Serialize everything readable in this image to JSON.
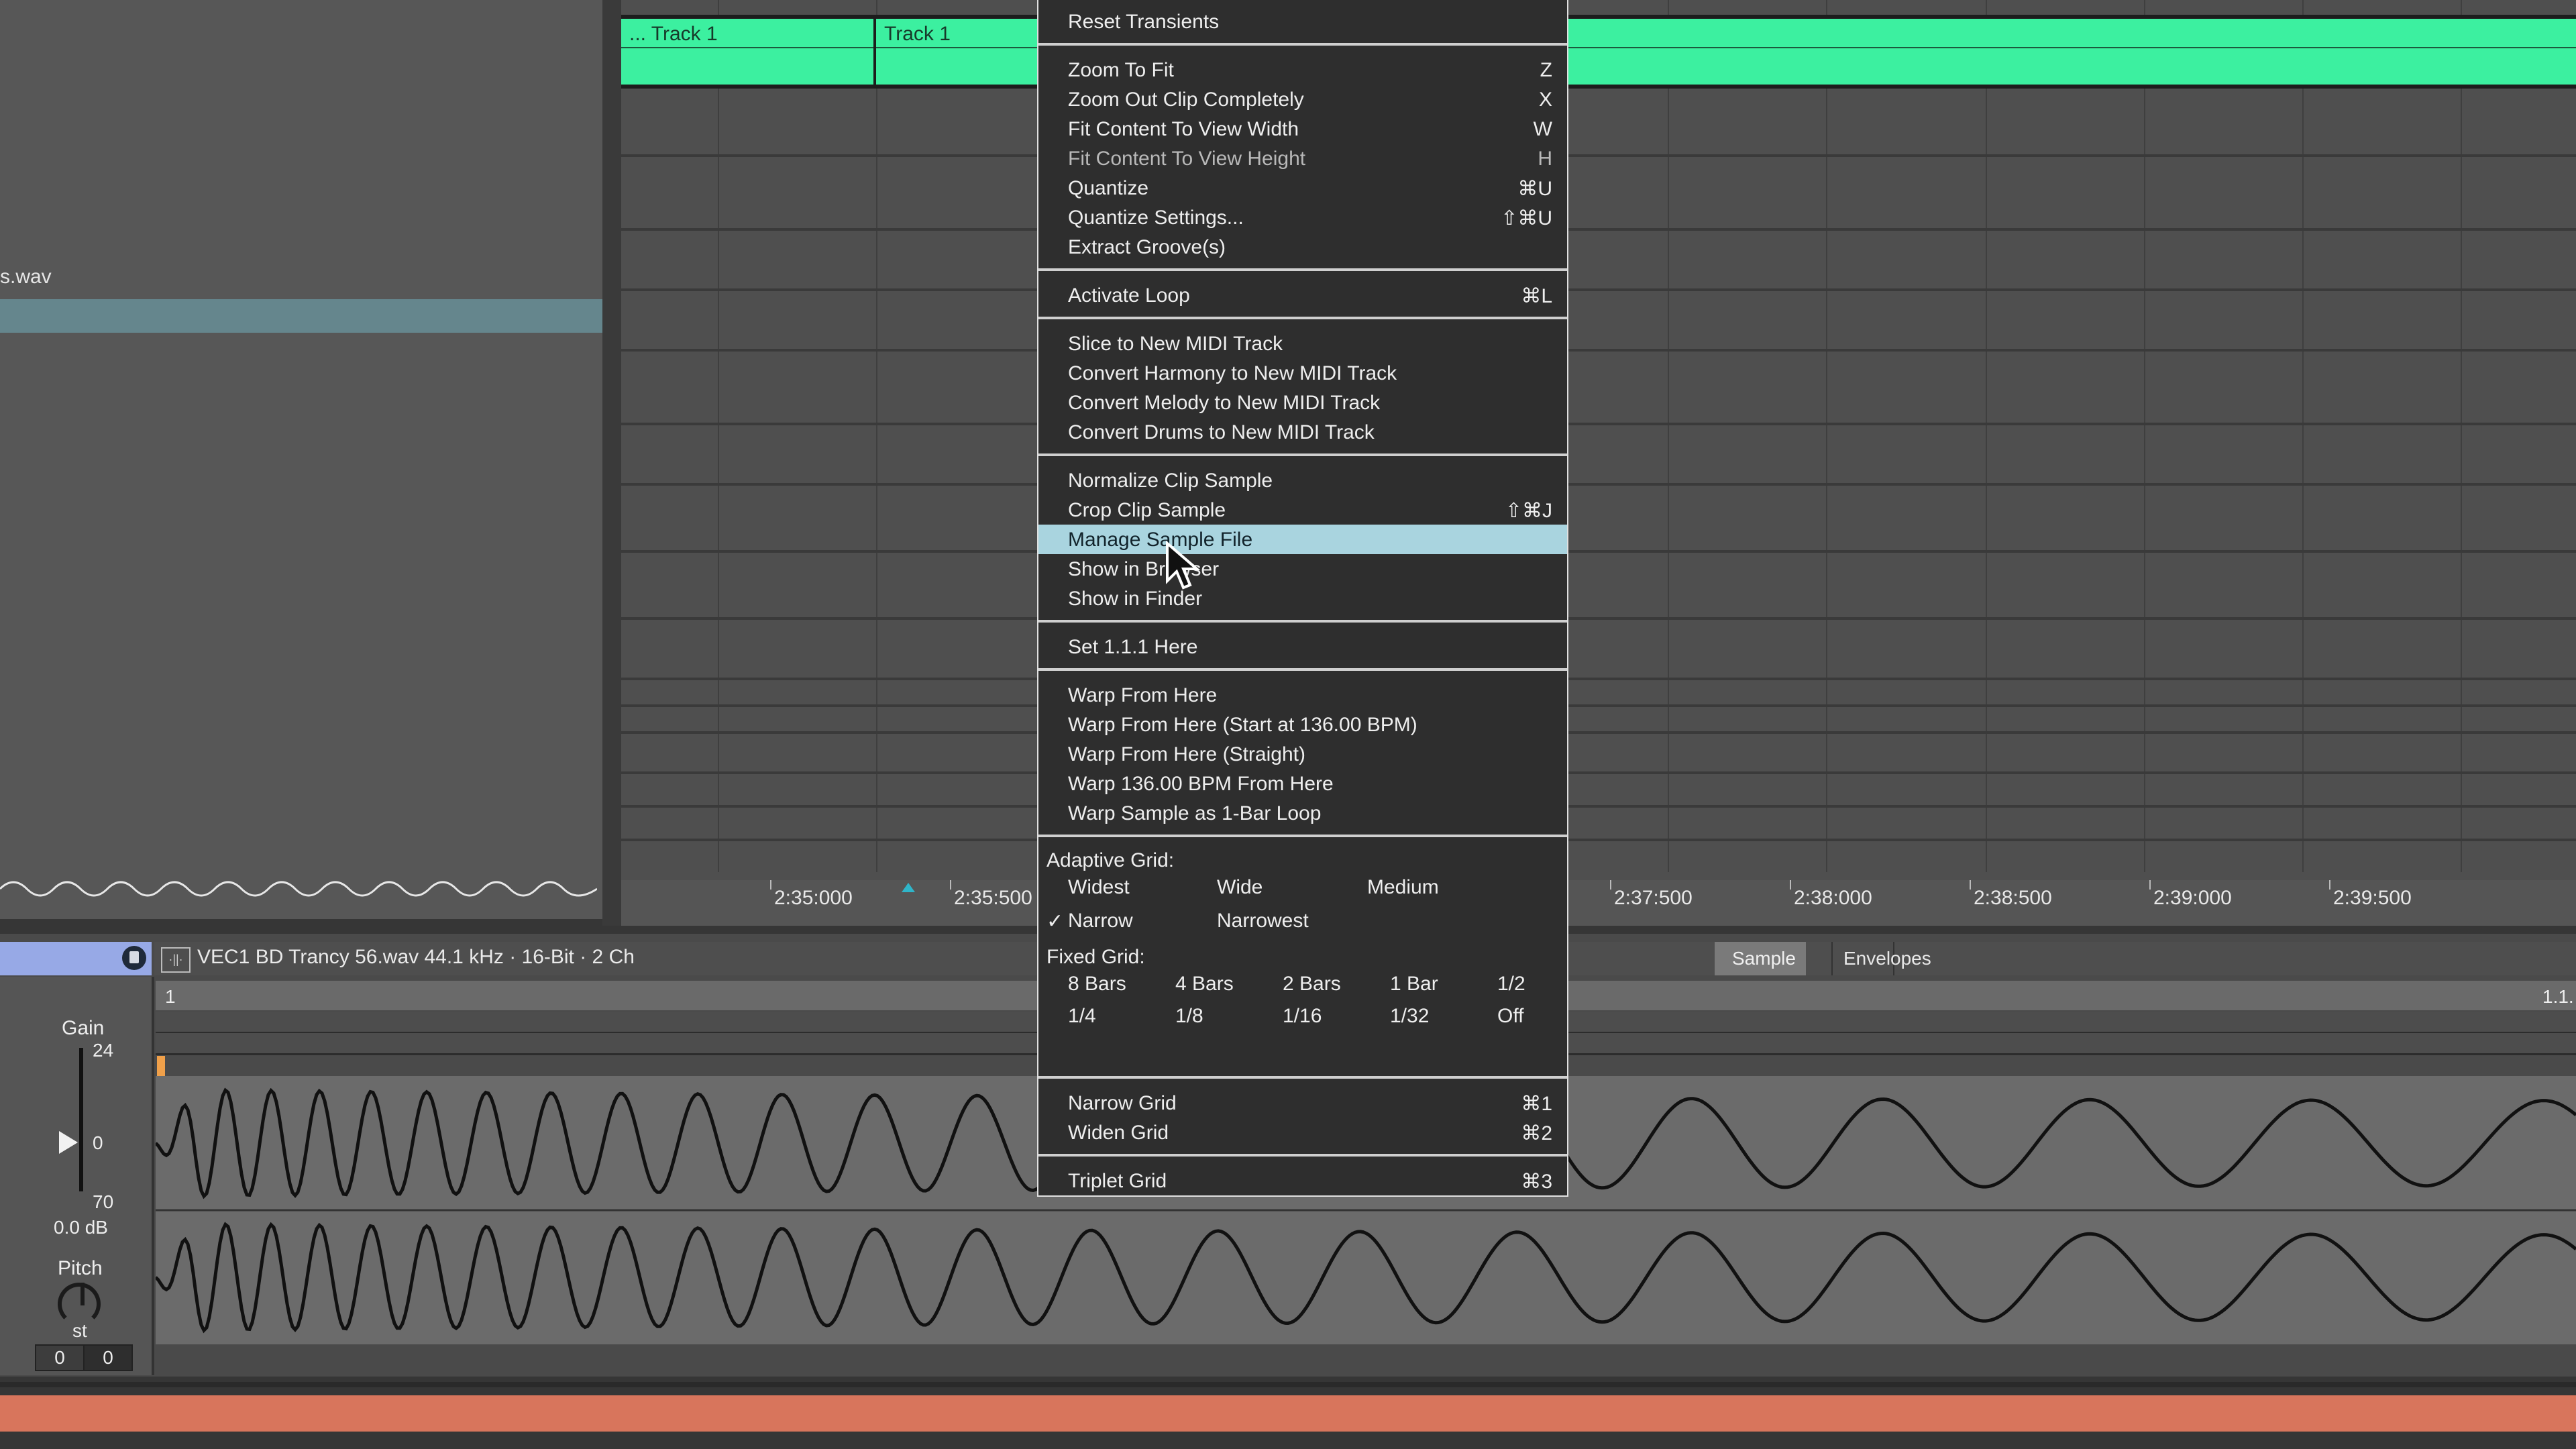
{
  "browser": {
    "file_name_fragment": "s.wav"
  },
  "arrangement": {
    "clips": [
      {
        "label": "... Track 1"
      },
      {
        "label": "Track 1"
      }
    ],
    "clip_color": "#3cf0a0",
    "ruler_ticks": [
      "2:35:000",
      "2:35:500",
      "2:37:500",
      "2:38:000",
      "2:38:500",
      "2:39:000",
      "2:39:500"
    ]
  },
  "context_menu": {
    "sections": [
      {
        "items": [
          {
            "label": "Reset Transients",
            "shortcut": "",
            "disabled": false
          }
        ]
      },
      {
        "items": [
          {
            "label": "Zoom To Fit",
            "shortcut": "Z"
          },
          {
            "label": "Zoom Out Clip Completely",
            "shortcut": "X"
          },
          {
            "label": "Fit Content To View Width",
            "shortcut": "W"
          },
          {
            "label": "Fit Content To View Height",
            "shortcut": "H",
            "disabled": true
          },
          {
            "label": "Quantize",
            "shortcut": "⌘U"
          },
          {
            "label": "Quantize Settings...",
            "shortcut": "⇧⌘U"
          },
          {
            "label": "Extract Groove(s)",
            "shortcut": ""
          }
        ]
      },
      {
        "items": [
          {
            "label": "Activate Loop",
            "shortcut": "⌘L"
          }
        ]
      },
      {
        "items": [
          {
            "label": "Slice to New MIDI Track",
            "shortcut": ""
          },
          {
            "label": "Convert Harmony to New MIDI Track",
            "shortcut": ""
          },
          {
            "label": "Convert Melody to New MIDI Track",
            "shortcut": ""
          },
          {
            "label": "Convert Drums to New MIDI Track",
            "shortcut": ""
          }
        ]
      },
      {
        "items": [
          {
            "label": "Normalize Clip Sample",
            "shortcut": ""
          },
          {
            "label": "Crop Clip Sample",
            "shortcut": "⇧⌘J"
          },
          {
            "label": "Manage Sample File",
            "shortcut": "",
            "highlighted": true
          },
          {
            "label": "Show in Browser",
            "shortcut": ""
          },
          {
            "label": "Show in Finder",
            "shortcut": ""
          }
        ]
      },
      {
        "items": [
          {
            "label": "Set 1.1.1 Here",
            "shortcut": ""
          }
        ]
      },
      {
        "items": [
          {
            "label": "Warp From Here",
            "shortcut": ""
          },
          {
            "label": "Warp From Here (Start at 136.00 BPM)",
            "shortcut": ""
          },
          {
            "label": "Warp From Here (Straight)",
            "shortcut": ""
          },
          {
            "label": "Warp 136.00 BPM From Here",
            "shortcut": ""
          },
          {
            "label": "Warp Sample as 1-Bar Loop",
            "shortcut": ""
          }
        ]
      }
    ],
    "adaptive_grid": {
      "header": "Adaptive Grid:",
      "options": [
        "Widest",
        "Wide",
        "Medium",
        "Narrow",
        "Narrowest"
      ],
      "selected": "Narrow",
      "check": "✓"
    },
    "fixed_grid": {
      "header": "Fixed Grid:",
      "options": [
        "8 Bars",
        "4 Bars",
        "2 Bars",
        "1 Bar",
        "1/2",
        "1/4",
        "1/8",
        "1/16",
        "1/32",
        "Off"
      ]
    },
    "grid_actions": [
      {
        "label": "Narrow Grid",
        "shortcut": "⌘1"
      },
      {
        "label": "Widen Grid",
        "shortcut": "⌘2"
      }
    ],
    "triplet": {
      "label": "Triplet Grid",
      "shortcut": "⌘3"
    }
  },
  "clip_detail": {
    "sample_info": "VEC1 BD Trancy 56.wav  44.1 kHz · 16-Bit · 2 Ch",
    "tabs": [
      "Sample",
      "Envelopes"
    ],
    "active_tab": "Sample",
    "ruler_start": "1",
    "ruler_end": "1.1.",
    "gain": {
      "label": "Gain",
      "max": "24",
      "mid": "0",
      "min": "70",
      "value": "0.0 dB"
    },
    "pitch": {
      "label": "Pitch",
      "unit": "st",
      "coarse": "0",
      "fine": "0"
    }
  }
}
